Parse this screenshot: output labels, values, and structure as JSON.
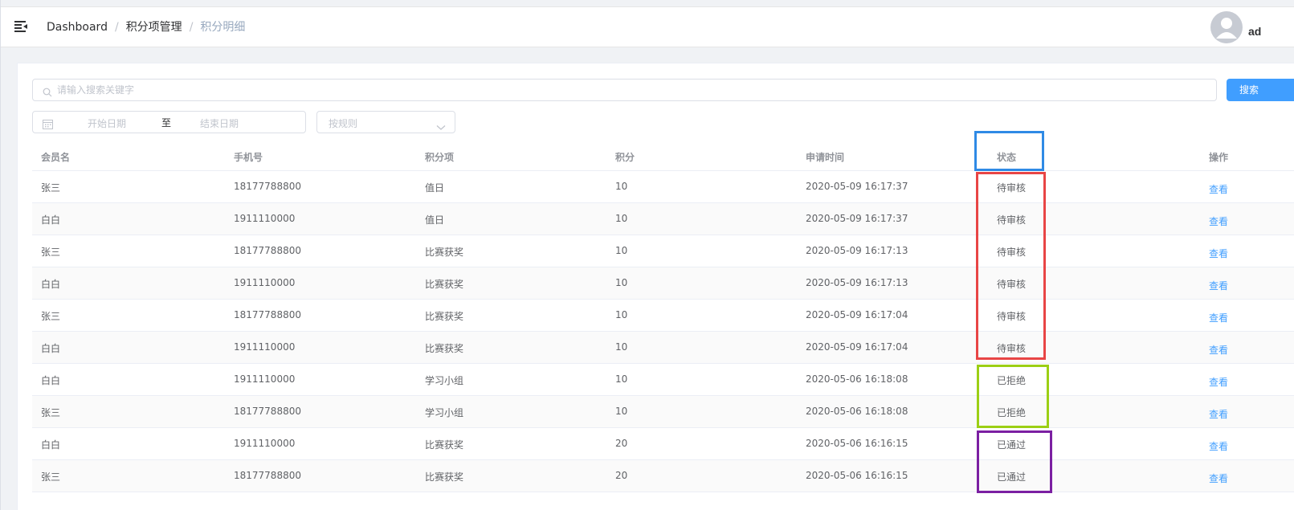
{
  "navbar": {
    "breadcrumb": [
      "Dashboard",
      "积分项管理",
      "积分明细"
    ],
    "breadcrumb_separator": "/",
    "user_name": "ad"
  },
  "filters": {
    "search_placeholder": "请输入搜索关键字",
    "search_button": "搜索",
    "date_start_placeholder": "开始日期",
    "date_separator": "至",
    "date_end_placeholder": "结束日期",
    "rule_placeholder": "按规则"
  },
  "table": {
    "headers": {
      "member": "会员名",
      "phone": "手机号",
      "item": "积分项",
      "points": "积分",
      "time": "申请时间",
      "status": "状态",
      "action": "操作"
    },
    "rows": [
      {
        "member": "张三",
        "phone": "18177788800",
        "item": "值日",
        "points": "10",
        "time": "2020-05-09 16:17:37",
        "status": "待审核",
        "action": "查看"
      },
      {
        "member": "白白",
        "phone": "1911110000",
        "item": "值日",
        "points": "10",
        "time": "2020-05-09 16:17:37",
        "status": "待审核",
        "action": "查看"
      },
      {
        "member": "张三",
        "phone": "18177788800",
        "item": "比赛获奖",
        "points": "10",
        "time": "2020-05-09 16:17:13",
        "status": "待审核",
        "action": "查看"
      },
      {
        "member": "白白",
        "phone": "1911110000",
        "item": "比赛获奖",
        "points": "10",
        "time": "2020-05-09 16:17:13",
        "status": "待审核",
        "action": "查看"
      },
      {
        "member": "张三",
        "phone": "18177788800",
        "item": "比赛获奖",
        "points": "10",
        "time": "2020-05-09 16:17:04",
        "status": "待审核",
        "action": "查看"
      },
      {
        "member": "白白",
        "phone": "1911110000",
        "item": "比赛获奖",
        "points": "10",
        "time": "2020-05-09 16:17:04",
        "status": "待审核",
        "action": "查看"
      },
      {
        "member": "白白",
        "phone": "1911110000",
        "item": "学习小组",
        "points": "10",
        "time": "2020-05-06 16:18:08",
        "status": "已拒绝",
        "action": "查看"
      },
      {
        "member": "张三",
        "phone": "18177788800",
        "item": "学习小组",
        "points": "10",
        "time": "2020-05-06 16:18:08",
        "status": "已拒绝",
        "action": "查看"
      },
      {
        "member": "白白",
        "phone": "1911110000",
        "item": "比赛获奖",
        "points": "20",
        "time": "2020-05-06 16:16:15",
        "status": "已通过",
        "action": "查看"
      },
      {
        "member": "张三",
        "phone": "18177788800",
        "item": "比赛获奖",
        "points": "20",
        "time": "2020-05-06 16:16:15",
        "status": "已通过",
        "action": "查看"
      }
    ]
  },
  "annotations": {
    "status_header": "#2f8ae5",
    "pending": "#e84545",
    "rejected": "#9ccf14",
    "approved": "#7b1fa2"
  },
  "colors": {
    "primary": "#409eff",
    "text": "#606266",
    "header_text": "#909399",
    "placeholder": "#c0c4cc",
    "page_background": "#f0f2f5"
  }
}
